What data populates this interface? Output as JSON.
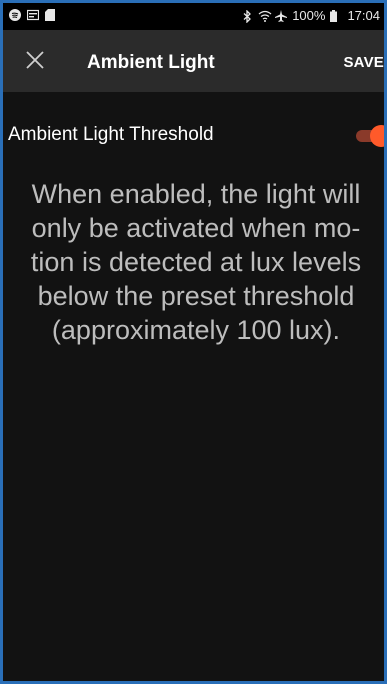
{
  "status_bar": {
    "battery": "100%",
    "time": "17:04",
    "left_icons": [
      "spotify-icon",
      "card-icon",
      "sd-card-icon"
    ],
    "right_icons": [
      "bluetooth-icon",
      "wifi-icon",
      "airplane-icon",
      "battery-icon"
    ]
  },
  "toolbar": {
    "title": "Ambient Light",
    "save_label": "SAVE"
  },
  "setting": {
    "label": "Ambient Light Threshold",
    "enabled": true
  },
  "description": "When enabled, the light will only be activated when mo-tion is detected at lux levels below the preset threshold (approximately 100 lux).",
  "colors": {
    "accent": "#ff5a2a",
    "background": "#121212",
    "toolbar": "#2b2b2b"
  }
}
